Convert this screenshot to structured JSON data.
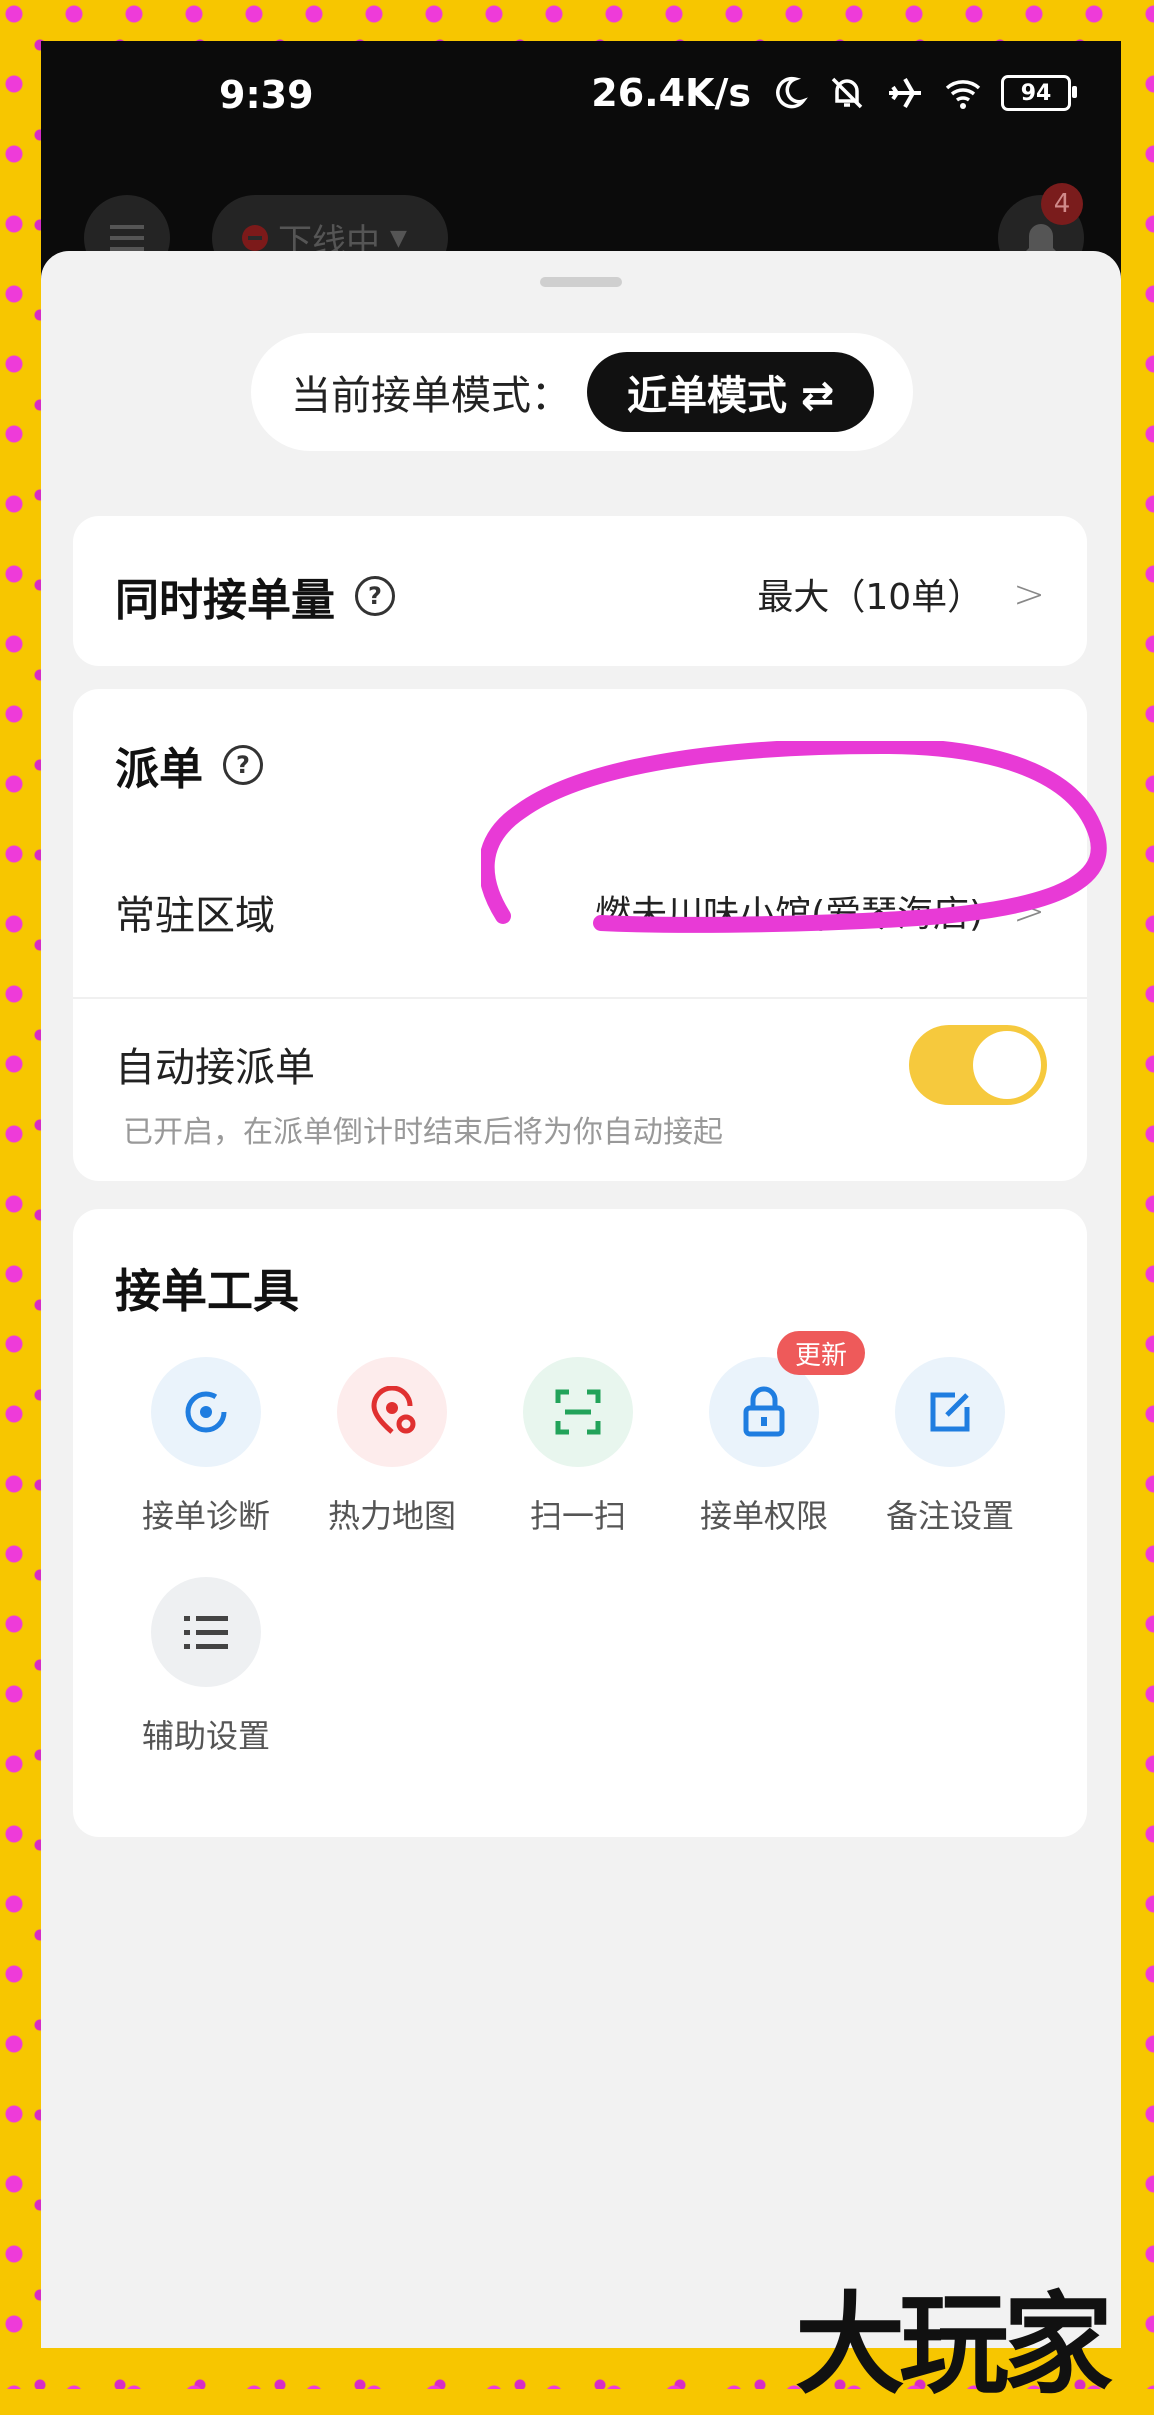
{
  "status_bar": {
    "time": "9:39",
    "network_speed": "26.4K/s",
    "battery": "94",
    "icons": [
      "moon-icon",
      "mute-icon",
      "airplane-icon",
      "wifi-icon"
    ]
  },
  "top_bar": {
    "status_label": "下线中",
    "notification_count": "4"
  },
  "mode": {
    "label": "当前接单模式：",
    "value": "近单模式 ⇄"
  },
  "concurrent": {
    "title": "同时接单量",
    "value": "最大（10单）"
  },
  "dispatch": {
    "title": "派单",
    "area_label": "常驻区域",
    "area_value": "燃未川味小馆(爱琴海店)",
    "auto_label": "自动接派单",
    "auto_desc": "已开启，在派单倒计时结束后将为你自动接起",
    "auto_enabled": true
  },
  "tools": {
    "title": "接单工具",
    "new_badge": "更新",
    "items": [
      {
        "label": "接单诊断",
        "icon": "diagnosis-icon"
      },
      {
        "label": "热力地图",
        "icon": "heatmap-icon"
      },
      {
        "label": "扫一扫",
        "icon": "scan-icon"
      },
      {
        "label": "接单权限",
        "icon": "lock-icon"
      },
      {
        "label": "备注设置",
        "icon": "edit-note-icon"
      },
      {
        "label": "辅助设置",
        "icon": "list-settings-icon"
      }
    ]
  },
  "colors": {
    "frame": "#f7c600",
    "dots": "#ee3bd9",
    "toggle_on": "#f6c93d",
    "badge": "#ee5a5a",
    "annotation": "#e83ad6"
  },
  "watermark": "大玩家"
}
